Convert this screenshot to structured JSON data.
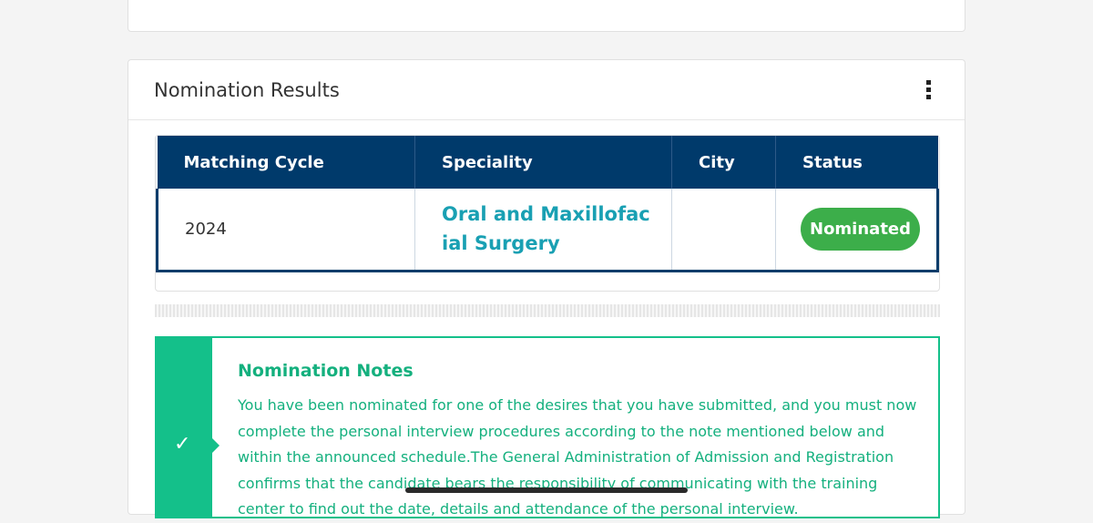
{
  "card": {
    "title": "Nomination Results"
  },
  "table": {
    "headers": [
      "Matching Cycle",
      "Speciality",
      "City",
      "Status"
    ],
    "rows": [
      {
        "cycle": "2024",
        "speciality": "Oral and Maxillofacial Surgery",
        "city": "",
        "status": "Nominated"
      }
    ]
  },
  "notes": {
    "title": "Nomination Notes",
    "body": "You have been nominated for one of the desires that you have submitted, and you must now complete the personal interview procedures according to the note mentioned below and within the announced schedule.The General Administration of Admission and Registration confirms that the candidate bears the responsibility of communicating with the training center to find out the date, details and attendance of the personal interview."
  },
  "colors": {
    "header_bg": "#003a6b",
    "accent_green": "#14c08a",
    "badge_green": "#3cae4a",
    "speciality_teal": "#19a0b3"
  }
}
